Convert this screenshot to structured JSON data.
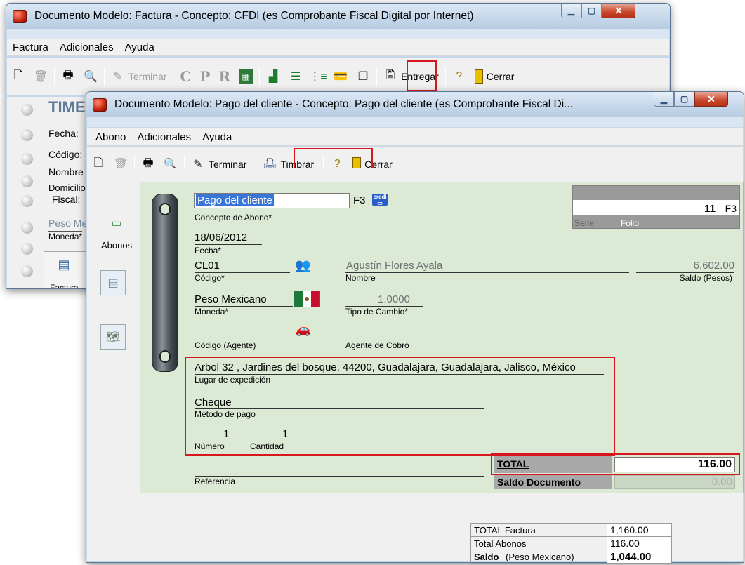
{
  "back_window": {
    "title": "Documento Modelo: Factura - Concepto: CFDI (es Comprobante Fiscal Digital por Internet)",
    "menu": [
      "Factura",
      "Adicionales",
      "Ayuda"
    ],
    "toolbar": {
      "terminar": "Terminar",
      "entregar": "Entregar",
      "cerrar": "Cerrar"
    },
    "sidebar": {
      "timbre_partial": "TIME",
      "fecha": "Fecha:",
      "codigo": "Código:",
      "nombre": "Nombre",
      "domicilio": "Domicilio",
      "fiscal": "Fiscal:",
      "peso": "Peso Me",
      "moneda": "Moneda*",
      "factura": "Factura"
    }
  },
  "front_window": {
    "title": "Documento Modelo: Pago del cliente - Concepto: Pago del cliente (es Comprobante Fiscal Di...",
    "menu": [
      "Abono",
      "Adicionales",
      "Ayuda"
    ],
    "toolbar": {
      "terminar": "Terminar",
      "timbrar": "Timbrar",
      "cerrar": "Cerrar"
    },
    "side_tab": "Abonos",
    "form": {
      "concepto_value": "Pago del cliente",
      "concepto_f3": "F3",
      "concepto_label": "Concepto de Abono*",
      "folio_value": "11",
      "folio_f3": "F3",
      "serie_label": "Serie",
      "folio_label": "Folio",
      "fecha_value": "18/06/2012",
      "fecha_label": "Fecha*",
      "codigo_value": "CL01",
      "codigo_label": "Código*",
      "nombre_value": "Agustín Flores Ayala",
      "nombre_label": "Nombre",
      "saldo_value": "6,602.00",
      "saldo_label": "Saldo (Pesos)",
      "moneda_value": "Peso Mexicano",
      "moneda_label": "Moneda*",
      "tipo_cambio_value": "1.0000",
      "tipo_cambio_label": "Tipo de Cambio*",
      "codigo_agente_label": "Código (Agente)",
      "agente_label": "Agente de Cobro",
      "lugar_value": "Arbol 32 , Jardines del bosque, 44200, Guadalajara, Guadalajara, Jalisco, México",
      "lugar_label": "Lugar de expedición",
      "metodo_value": "Cheque",
      "metodo_label": "Método de pago",
      "numero_value": "1",
      "numero_label": "Número",
      "cantidad_value": "1",
      "cantidad_label": "Cantidad",
      "referencia_label": "Referencia",
      "total_label": "TOTAL",
      "total_value": "116.00",
      "saldo_doc_label": "Saldo Documento",
      "saldo_doc_value": "0.00"
    },
    "summary": {
      "total_factura_label": "TOTAL Factura",
      "total_factura_value": "1,160.00",
      "total_abonos_label": "Total Abonos",
      "total_abonos_value": "116.00",
      "saldo_label": "Saldo",
      "saldo_currency": "(Peso Mexicano)",
      "saldo_value": "1,044.00"
    }
  },
  "colors": {
    "highlight": "#d7171d",
    "panel": "#dce9d5",
    "selection": "#3875d7"
  }
}
